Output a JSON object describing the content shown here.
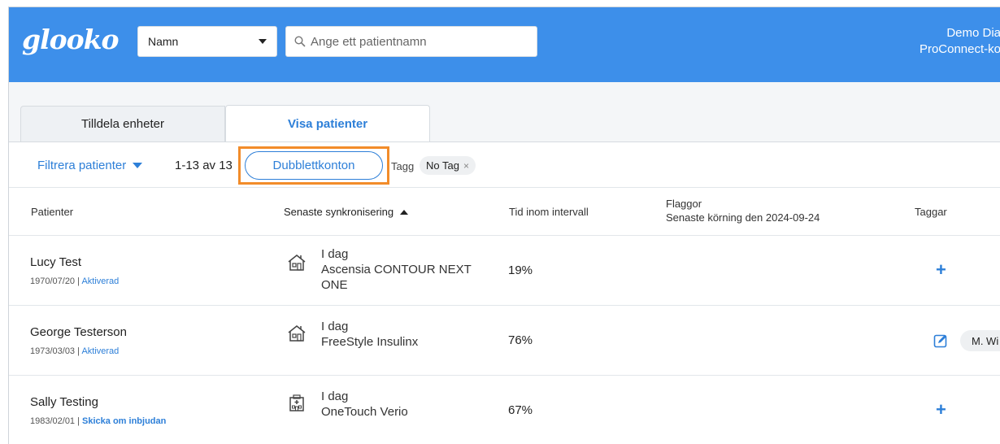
{
  "header": {
    "logo": "glooko",
    "search_type": "Namn",
    "search_placeholder": "Ange ett patientnamn",
    "user_line1": "Demo Dia",
    "user_line2": "ProConnect-ko"
  },
  "tabs": {
    "assign": "Tilldela enheter",
    "view": "Visa patienter"
  },
  "filter": {
    "filter_label": "Filtrera patienter",
    "range": "1-13 av 13",
    "duplicates": "Dubblettkonton",
    "tag_label": "Tagg",
    "tag_chip": "No Tag",
    "tag_chip_close": "×"
  },
  "table": {
    "columns": {
      "patients": "Patienter",
      "sync": "Senaste synkronisering",
      "time_in_range": "Tid inom intervall",
      "flags": "Flaggor",
      "flags_sub": "Senaste körning den 2024-09-24",
      "tags": "Taggar"
    },
    "rows": [
      {
        "name": "Lucy Test",
        "dob": "1970/07/20",
        "sep": " | ",
        "status": "Aktiverad",
        "sync_day": "I dag",
        "sync_device": "Ascensia CONTOUR NEXT ONE",
        "time_in_range": "19%",
        "tag_action": "+",
        "sync_icon": "home-icon"
      },
      {
        "name": "George Testerson",
        "dob": "1973/03/03",
        "sep": " | ",
        "status": "Aktiverad",
        "sync_day": "I dag",
        "sync_device": "FreeStyle Insulinx",
        "time_in_range": "76%",
        "tag": "M. Wi",
        "sync_icon": "home-icon"
      },
      {
        "name": "Sally Testing",
        "dob": "1983/02/01",
        "sep": " | ",
        "status": "Skicka om inbjudan",
        "sync_day": "I dag",
        "sync_device": "OneTouch Verio",
        "time_in_range": "67%",
        "tag_action": "+",
        "sync_icon": "clinic-icon"
      }
    ]
  },
  "colors": {
    "header_bg": "#3d8fea",
    "accent": "#2d7fd8",
    "highlight": "#f28c2a"
  }
}
